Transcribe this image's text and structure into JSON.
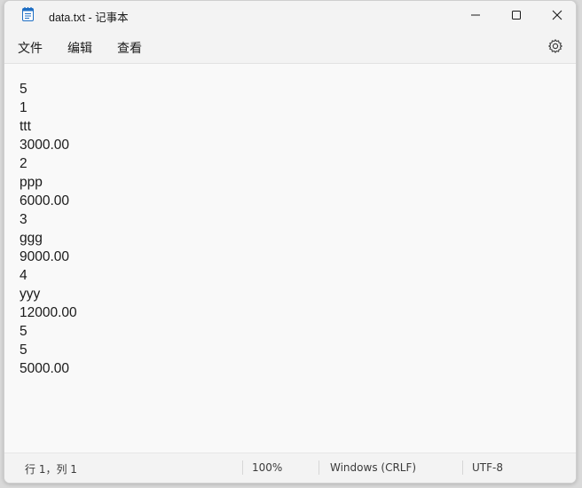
{
  "window": {
    "title": "data.txt - 记事本"
  },
  "menu": {
    "items": [
      "文件",
      "编辑",
      "查看"
    ]
  },
  "editor": {
    "lines": [
      "5",
      "1",
      "ttt",
      "3000.00",
      "2",
      "ppp",
      "6000.00",
      "3",
      "ggg",
      "9000.00",
      "4",
      "yyy",
      "12000.00",
      "5",
      "5",
      "5000.00"
    ]
  },
  "status": {
    "position": "行 1，列 1",
    "zoom": "100%",
    "line_ending": "Windows (CRLF)",
    "encoding": "UTF-8"
  },
  "icons": {
    "app": "notepad-icon",
    "minimize": "minimize-icon",
    "maximize": "maximize-icon",
    "close": "close-icon",
    "settings": "gear-icon"
  },
  "colors": {
    "accent": "#0067c0",
    "background": "#f9f9f9",
    "chrome": "#f3f3f3"
  }
}
